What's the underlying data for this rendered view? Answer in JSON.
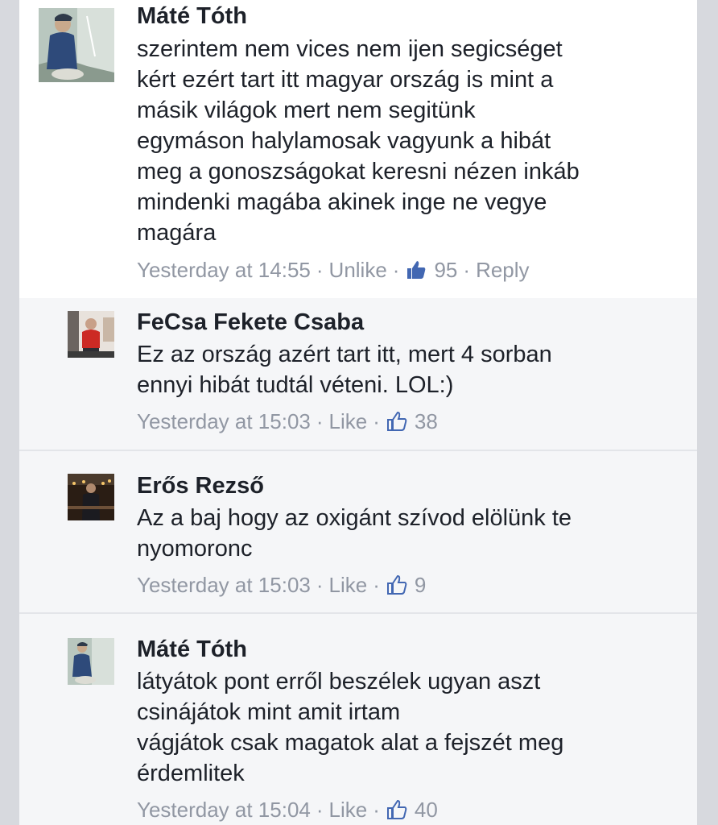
{
  "comments": [
    {
      "author": "Máté Tóth",
      "text": "szerintem nem vices nem ijen segicséget\nkért ezért tart itt magyar ország is mint a\nmásik világok mert nem segitünk\negymáson halylamosak vagyunk a hibát\nmeg a gonoszságokat keresni nézen inkáb\nmindenki magába akinek inge ne vegye\nmagára",
      "time": "Yesterday at 14:55",
      "action": "Unlike",
      "likes": "95",
      "reply": "Reply",
      "avatar_icon": "profile-photo-fisherman"
    },
    {
      "author": "FeCsa Fekete Csaba",
      "text": "Ez az ország azért tart itt, mert 4 sorban\nennyi hibát tudtál véteni.  LOL:)",
      "time": "Yesterday at 15:03",
      "action": "Like",
      "likes": "38",
      "avatar_icon": "profile-photo-red-shirt"
    },
    {
      "author": "Erős Rezső",
      "text": "Az a baj hogy az oxigánt szívod elölünk te\nnyomoronc",
      "time": "Yesterday at 15:03",
      "action": "Like",
      "likes": "9",
      "avatar_icon": "profile-photo-night-city"
    },
    {
      "author": "Máté Tóth",
      "text": "látyátok pont erről beszélek ugyan aszt\ncsinájátok mint amit irtam\nvágjátok csak magatok alat a fejszét meg\nérdemlitek",
      "time": "Yesterday at 15:04",
      "action": "Like",
      "likes": "40",
      "avatar_icon": "profile-photo-fisherman"
    }
  ],
  "colors": {
    "text": "#1d2129",
    "meta": "#9197a3",
    "like_icon": "#4267b2",
    "reply_background": "#f5f6f8"
  }
}
